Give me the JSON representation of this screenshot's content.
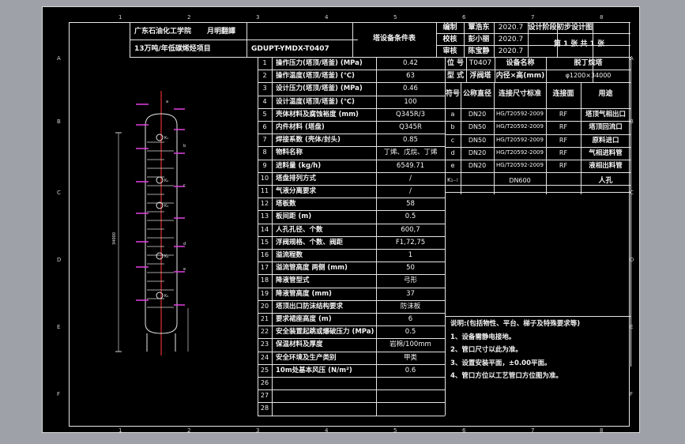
{
  "title_block": {
    "school": "广东石油化工学院",
    "dept": "月明翻譯",
    "project": "13万吨/年低碳烯烃项目",
    "drawing_no": "GDUPT-YMDX-T0407",
    "sheet_title": "塔设备条件表",
    "roles": [
      {
        "role": "编制",
        "name": "覃浩东",
        "date": "2020.7"
      },
      {
        "role": "校核",
        "name": "彭小丽",
        "date": "2020.7"
      },
      {
        "role": "审核",
        "name": "陈宝静",
        "date": "2020.7"
      }
    ],
    "stage_label": "设计阶段",
    "stage_value": "初步设计图",
    "sheet_count": "第 1 张    共 1 张"
  },
  "equip": {
    "tag_label": "位 号",
    "tag_value": "T0407",
    "name_label": "设备名称",
    "name_value": "脱丁烷塔",
    "spec_label": "型 式",
    "spec_value": "浮阀塔",
    "size_label": "内径×高(mm)",
    "size_value": "φ1200×34000"
  },
  "param_rows": [
    {
      "no": "1",
      "name": "操作压力(塔顶/塔釜) (MPa)",
      "value": "0.42"
    },
    {
      "no": "2",
      "name": "操作温度(塔顶/塔釜) (℃)",
      "value": "63"
    },
    {
      "no": "3",
      "name": "设计压力(塔顶/塔釜) (MPa)",
      "value": "0.46"
    },
    {
      "no": "4",
      "name": "设计温度(塔顶/塔釜) (℃)",
      "value": "100"
    },
    {
      "no": "5",
      "name": "壳体材料及腐蚀裕度 (mm)",
      "value": "Q345R/3"
    },
    {
      "no": "6",
      "name": "内件材料 (塔盘)",
      "value": "Q345R"
    },
    {
      "no": "7",
      "name": "焊接系数 (壳体/封头)",
      "value": "0.85"
    },
    {
      "no": "8",
      "name": "物料名称",
      "value": "丁烯、戊烷、丁烯"
    },
    {
      "no": "9",
      "name": "进料量 (kg/h)",
      "value": "6549.71"
    },
    {
      "no": "10",
      "name": "塔盘排列方式",
      "value": "/"
    },
    {
      "no": "11",
      "name": "气液分离要求",
      "value": "/"
    },
    {
      "no": "12",
      "name": "塔板数",
      "value": "58"
    },
    {
      "no": "13",
      "name": "板间距 (m)",
      "value": "0.5"
    },
    {
      "no": "14",
      "name": "人孔孔径、个数",
      "value": "600,7"
    },
    {
      "no": "15",
      "name": "浮阀规格、个数、阀距",
      "value": "F1,72,75"
    },
    {
      "no": "16",
      "name": "溢流程数",
      "value": "1"
    },
    {
      "no": "17",
      "name": "溢流管高度 两侧 (mm)",
      "value": "50"
    },
    {
      "no": "18",
      "name": "降液管型式",
      "value": "弓形"
    },
    {
      "no": "19",
      "name": "降液管高度 (mm)",
      "value": "37"
    },
    {
      "no": "20",
      "name": "塔顶出口防沫结构要求",
      "value": "防沫板"
    },
    {
      "no": "21",
      "name": "要求裙座高度 (m)",
      "value": "6"
    },
    {
      "no": "22",
      "name": "安全装置起跳或爆破压力 (MPa)",
      "value": "0.5"
    },
    {
      "no": "23",
      "name": "保温材料及厚度",
      "value": "岩棉/100mm"
    },
    {
      "no": "24",
      "name": "安全环境及生产类别",
      "value": "甲类"
    },
    {
      "no": "25",
      "name": "10m处基本风压 (N/m²)",
      "value": "0.6"
    },
    {
      "no": "26",
      "name": "",
      "value": ""
    },
    {
      "no": "27",
      "name": "",
      "value": ""
    },
    {
      "no": "28",
      "name": "",
      "value": ""
    }
  ],
  "nozzle_header": {
    "c1": "符号",
    "c2": "公称直径",
    "c3": "连接尺寸标准",
    "c4": "连接面",
    "c5": "用途"
  },
  "nozzles": [
    {
      "sym": "a",
      "dn": "DN20",
      "std": "HG/T20592-2009",
      "face": "RF",
      "use": "塔顶气相出口"
    },
    {
      "sym": "b",
      "dn": "DN50",
      "std": "HG/T20592-2009",
      "face": "RF",
      "use": "塔顶回流口"
    },
    {
      "sym": "c",
      "dn": "DN50",
      "std": "HG/T20592-2009",
      "face": "RF",
      "use": "原料进口"
    },
    {
      "sym": "d",
      "dn": "DN20",
      "std": "HG/T20592-2009",
      "face": "RF",
      "use": "气相进料管"
    },
    {
      "sym": "e",
      "dn": "DN20",
      "std": "HG/T20592-2009",
      "face": "RF",
      "use": "液相出料管"
    }
  ],
  "manhole": {
    "sym": "K₁₋₇",
    "dn": "DN600",
    "use": "人孔"
  },
  "notes_title": "说明:(包括物性、平台、梯子及特殊要求等)",
  "notes": [
    "1、设备需静电接地。",
    "2、管口尺寸以此为准。",
    "3、设置安装平面，±0.00平面。",
    "4、管口方位以工艺管口方位图为准。"
  ],
  "border_letters": [
    "A",
    "B",
    "C",
    "D",
    "E",
    "F"
  ],
  "border_numbers": [
    "1",
    "2",
    "3",
    "4",
    "5",
    "6",
    "7",
    "8"
  ],
  "sketch": {
    "height_label": "34000",
    "nozzle_labels": [
      "a",
      "K₁",
      "K₂",
      "K₃",
      "K₄",
      "K₅",
      "b",
      "c",
      "d",
      "e"
    ]
  }
}
